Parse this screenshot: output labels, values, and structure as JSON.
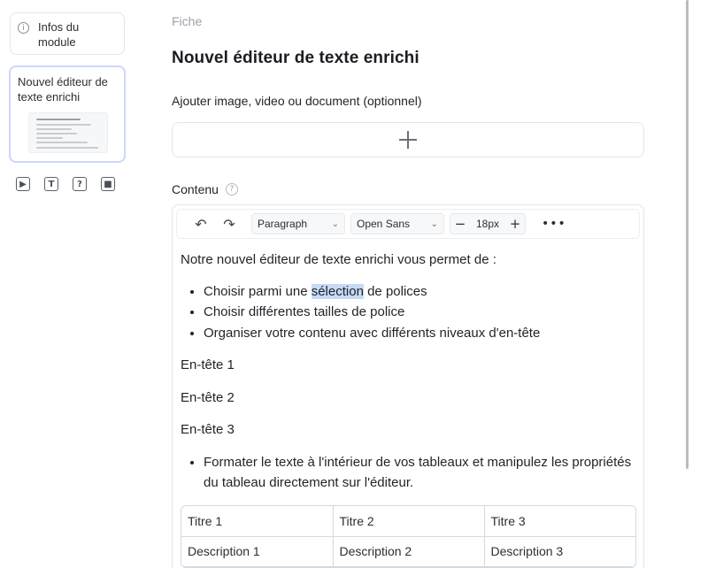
{
  "sidebar": {
    "infos_label": "Infos du module",
    "selected_card_label": "Nouvel éditeur de texte enrichi",
    "tool_icons": [
      "video-icon",
      "text-icon",
      "quiz-icon",
      "camera-icon"
    ],
    "tool_glyphs": [
      "▶",
      "T",
      "?",
      "■"
    ]
  },
  "main": {
    "breadcrumb": "Fiche",
    "title": "Nouvel éditeur de texte enrichi",
    "media_label": "Ajouter image, video ou document (optionnel)",
    "content_label": "Contenu"
  },
  "toolbar": {
    "block_type": "Paragraph",
    "font_family": "Open Sans",
    "font_size": "18px",
    "minus": "−",
    "plus": "+",
    "more": "•••",
    "undo": "↶",
    "redo": "↷"
  },
  "editor": {
    "intro": "Notre nouvel éditeur de texte enrichi vous permet de :",
    "bullet1_before": "Choisir parmi une ",
    "bullet1_selected": "sélection",
    "bullet1_after": " de polices",
    "bullet2": "Choisir différentes tailles de police",
    "bullet3": "Organiser votre contenu avec différents niveaux d'en-tête",
    "heading1": "En-tête 1",
    "heading2": "En-tête 2",
    "heading3": "En-tête 3",
    "bullet4": "Formater le texte à l'intérieur de vos tableaux et manipulez les propriétés du tableau directement sur l'éditeur."
  },
  "table": {
    "headers": [
      "Titre 1",
      "Titre 2",
      "Titre 3"
    ],
    "rows": [
      [
        "Description 1",
        "Description 2",
        "Description 3"
      ]
    ]
  }
}
